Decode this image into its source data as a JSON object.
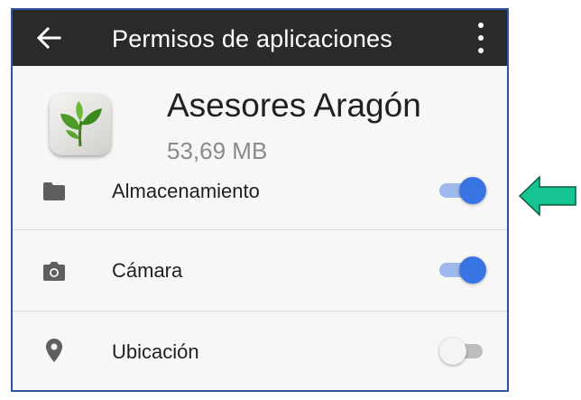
{
  "appbar": {
    "back_icon": "arrow-back-icon",
    "title": "Permisos de aplicaciones",
    "more_icon": "more-vert-icon"
  },
  "app": {
    "icon": "green-sprout-icon",
    "name": "Asesores Aragón",
    "size": "53,69 MB"
  },
  "permissions": [
    {
      "icon": "folder-icon",
      "label": "Almacenamiento",
      "enabled": true
    },
    {
      "icon": "camera-icon",
      "label": "Cámara",
      "enabled": true
    },
    {
      "icon": "location-pin-icon",
      "label": "Ubicación",
      "enabled": false
    }
  ],
  "colors": {
    "appbar_bg": "#2a2a2a",
    "toggle_on": "#3a74e2",
    "toggle_on_track": "#9fb9ec",
    "annotation_arrow": "#16c492"
  }
}
